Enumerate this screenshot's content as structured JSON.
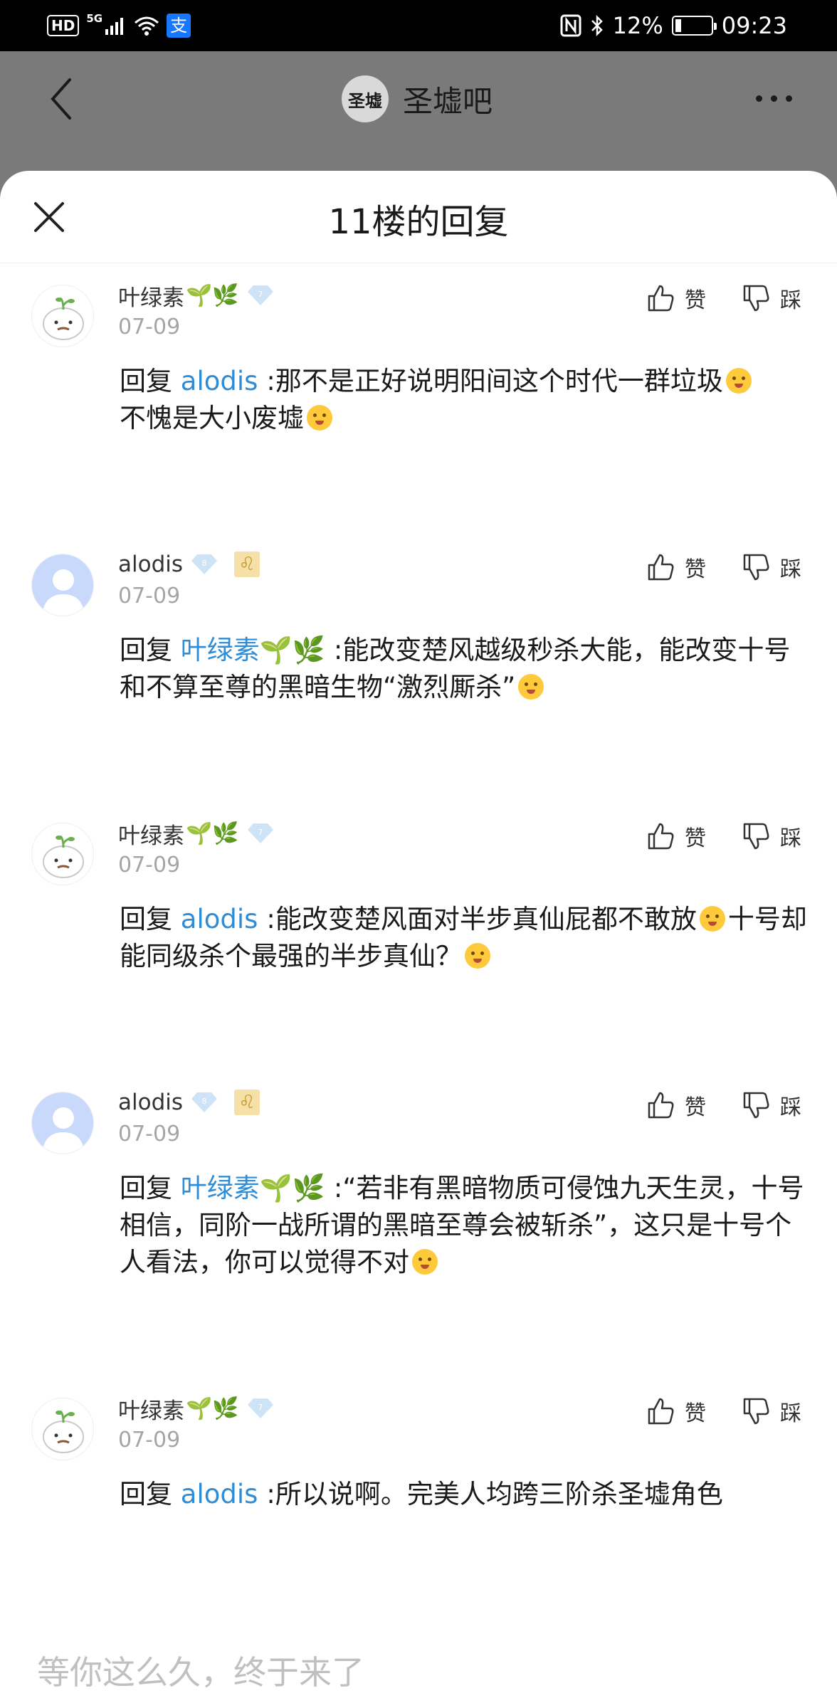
{
  "status_bar": {
    "hd": "HD",
    "network": "5G",
    "app_icon": "支",
    "battery": "12%",
    "time": "09:23"
  },
  "nav": {
    "title": "圣墟吧",
    "logo_text": "圣墟"
  },
  "sheet": {
    "title": "11楼的回复"
  },
  "actions": {
    "like": "赞",
    "dislike": "踩"
  },
  "replies": [
    {
      "user": "叶绿素",
      "user_emoji": "🌱🌿",
      "level": "7",
      "date": "07-09",
      "prefix": "回复",
      "mention": "alodis",
      "text_a": ":那不是正好说明阳间这个时代一群垃圾",
      "text_b": "不愧是大小废墟",
      "text_c": ""
    },
    {
      "user": "alodis",
      "user_emoji": "",
      "level": "8",
      "zodiac": "♌",
      "date": "07-09",
      "prefix": "回复",
      "mention": "叶绿素🌱🌿",
      "text_a": ":能改变楚风越级秒杀大能，能改变十号和不算至尊的黑暗生物“激烈厮杀”",
      "text_b": "",
      "text_c": ""
    },
    {
      "user": "叶绿素",
      "user_emoji": "🌱🌿",
      "level": "7",
      "date": "07-09",
      "prefix": "回复",
      "mention": "alodis",
      "text_a": ":能改变楚风面对半步真仙屁都不敢放",
      "text_b": "十号却能同级杀个最强的半步真仙？",
      "text_c": ""
    },
    {
      "user": "alodis",
      "user_emoji": "",
      "level": "8",
      "zodiac": "♌",
      "date": "07-09",
      "prefix": "回复",
      "mention": "叶绿素🌱🌿",
      "text_a": ":“若非有黑暗物质可侵蚀九天生灵，十号相信，同阶一战所谓的黑暗至尊会被斩杀”，这只是十号个人看法，你可以觉得不对",
      "text_b": "",
      "text_c": ""
    },
    {
      "user": "叶绿素",
      "user_emoji": "🌱🌿",
      "level": "7",
      "date": "07-09",
      "prefix": "回复",
      "mention": "alodis",
      "text_a": ":所以说啊。完美人均跨三阶杀圣墟角色",
      "text_b": "",
      "text_c": ""
    }
  ],
  "input": {
    "placeholder": "等你这么久，终于来了"
  }
}
